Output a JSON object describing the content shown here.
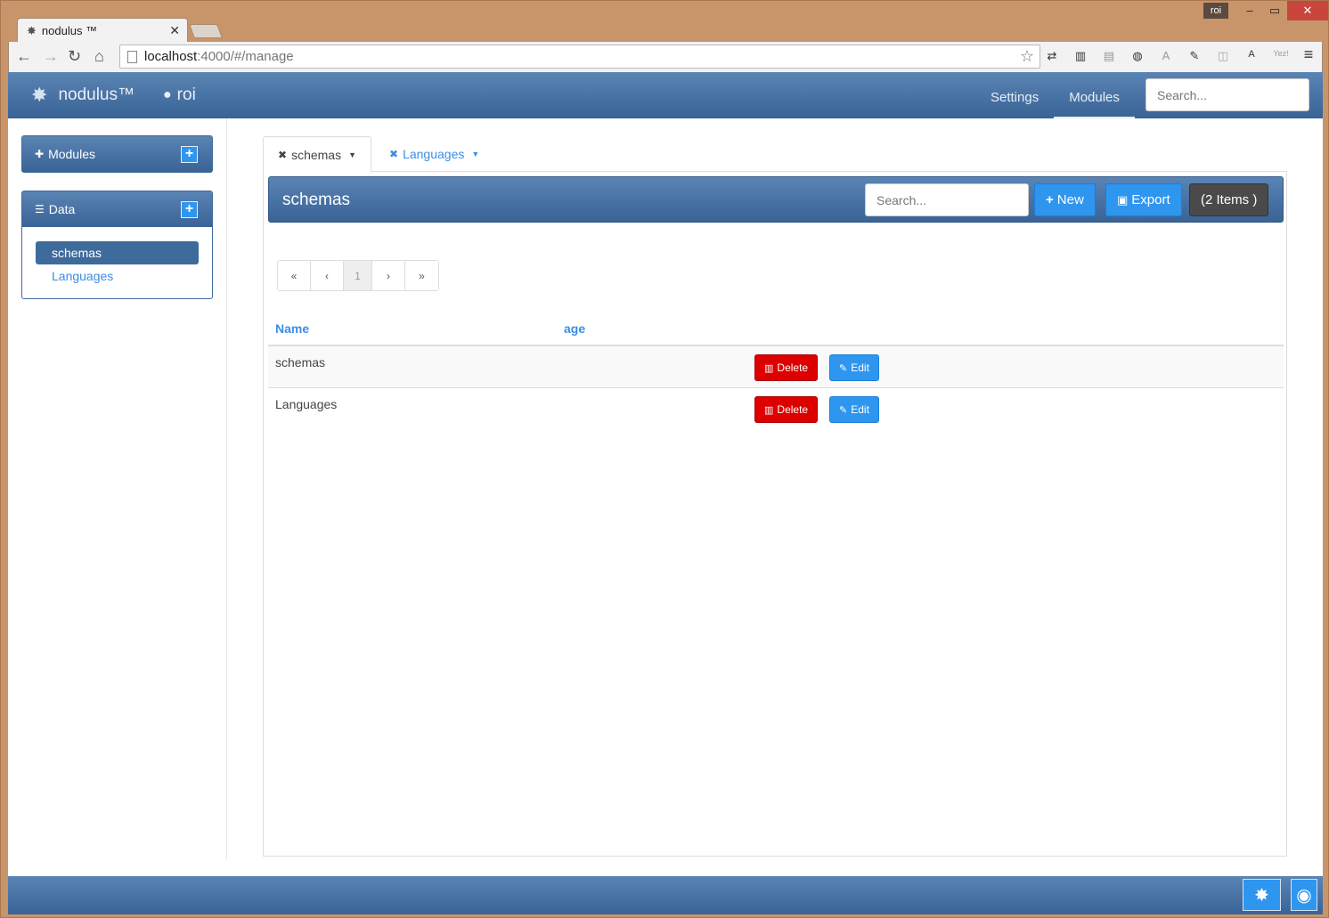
{
  "browser": {
    "tab_title": "nodulus ™",
    "window_user": "roi",
    "url_host": "localhost",
    "url_rest": ":4000/#/manage",
    "extensions": [
      "⇄",
      "▥",
      "▤",
      "◍",
      "A",
      "✎",
      "◫",
      "A",
      "Yez!"
    ]
  },
  "navbar": {
    "brand": "nodulus™",
    "user": "roi",
    "links": [
      "Settings",
      "Modules"
    ],
    "search_placeholder": "Search..."
  },
  "sidebar": {
    "modules_title": "Modules",
    "data_title": "Data",
    "items": [
      "schemas",
      "Languages"
    ]
  },
  "tabs": [
    {
      "label": "schemas"
    },
    {
      "label": "Languages"
    }
  ],
  "grid": {
    "title": "schemas",
    "search_placeholder": "Search...",
    "new_label": "New",
    "export_label": "Export",
    "count_label": "(2 Items )",
    "pager": {
      "first": "«",
      "prev": "‹",
      "current": "1",
      "next": "›",
      "last": "»"
    },
    "columns": [
      "Name",
      "age"
    ],
    "rows": [
      {
        "name": "schemas",
        "age": ""
      },
      {
        "name": "Languages",
        "age": ""
      }
    ],
    "delete_label": "Delete",
    "edit_label": "Edit"
  },
  "colors": {
    "brand_blue": "#3e6a9c",
    "accent_blue": "#2f96f0",
    "danger": "#dd0000"
  }
}
